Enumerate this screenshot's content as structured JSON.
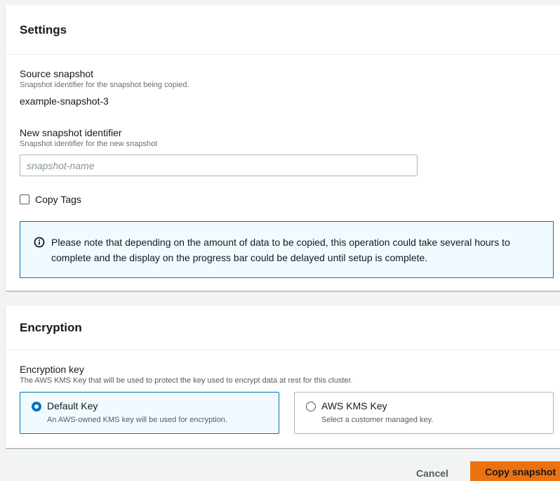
{
  "settings": {
    "title": "Settings",
    "source_snapshot": {
      "label": "Source snapshot",
      "description": "Snapshot identifier for the snapshot being copied.",
      "value": "example-snapshot-3"
    },
    "new_identifier": {
      "label": "New snapshot identifier",
      "description": "Snapshot identifier for the new snapshot",
      "placeholder": "snapshot-name",
      "value": ""
    },
    "copy_tags": {
      "label": "Copy Tags",
      "checked": false
    },
    "info": {
      "icon": "info-icon",
      "line1": "Please note that depending on the amount of data to be copied, this operation could take several hours to",
      "line2": "complete and the display on the progress bar could be delayed until setup is complete."
    }
  },
  "encryption": {
    "title": "Encryption",
    "key_label": "Encryption key",
    "key_description": "The AWS KMS Key that will be used to protect the key used to encrypt data at rest for this cluster.",
    "options": [
      {
        "title": "Default Key",
        "description": "An AWS-owned KMS key will be used for encryption.",
        "selected": true
      },
      {
        "title": "AWS KMS Key",
        "description": "Select a customer managed key.",
        "selected": false
      }
    ]
  },
  "actions": {
    "cancel_label": "Cancel",
    "submit_label": "Copy snapshot"
  },
  "colors": {
    "accent": "#0073bb",
    "primary_button": "#ec7211",
    "info_background": "#f1faff"
  }
}
